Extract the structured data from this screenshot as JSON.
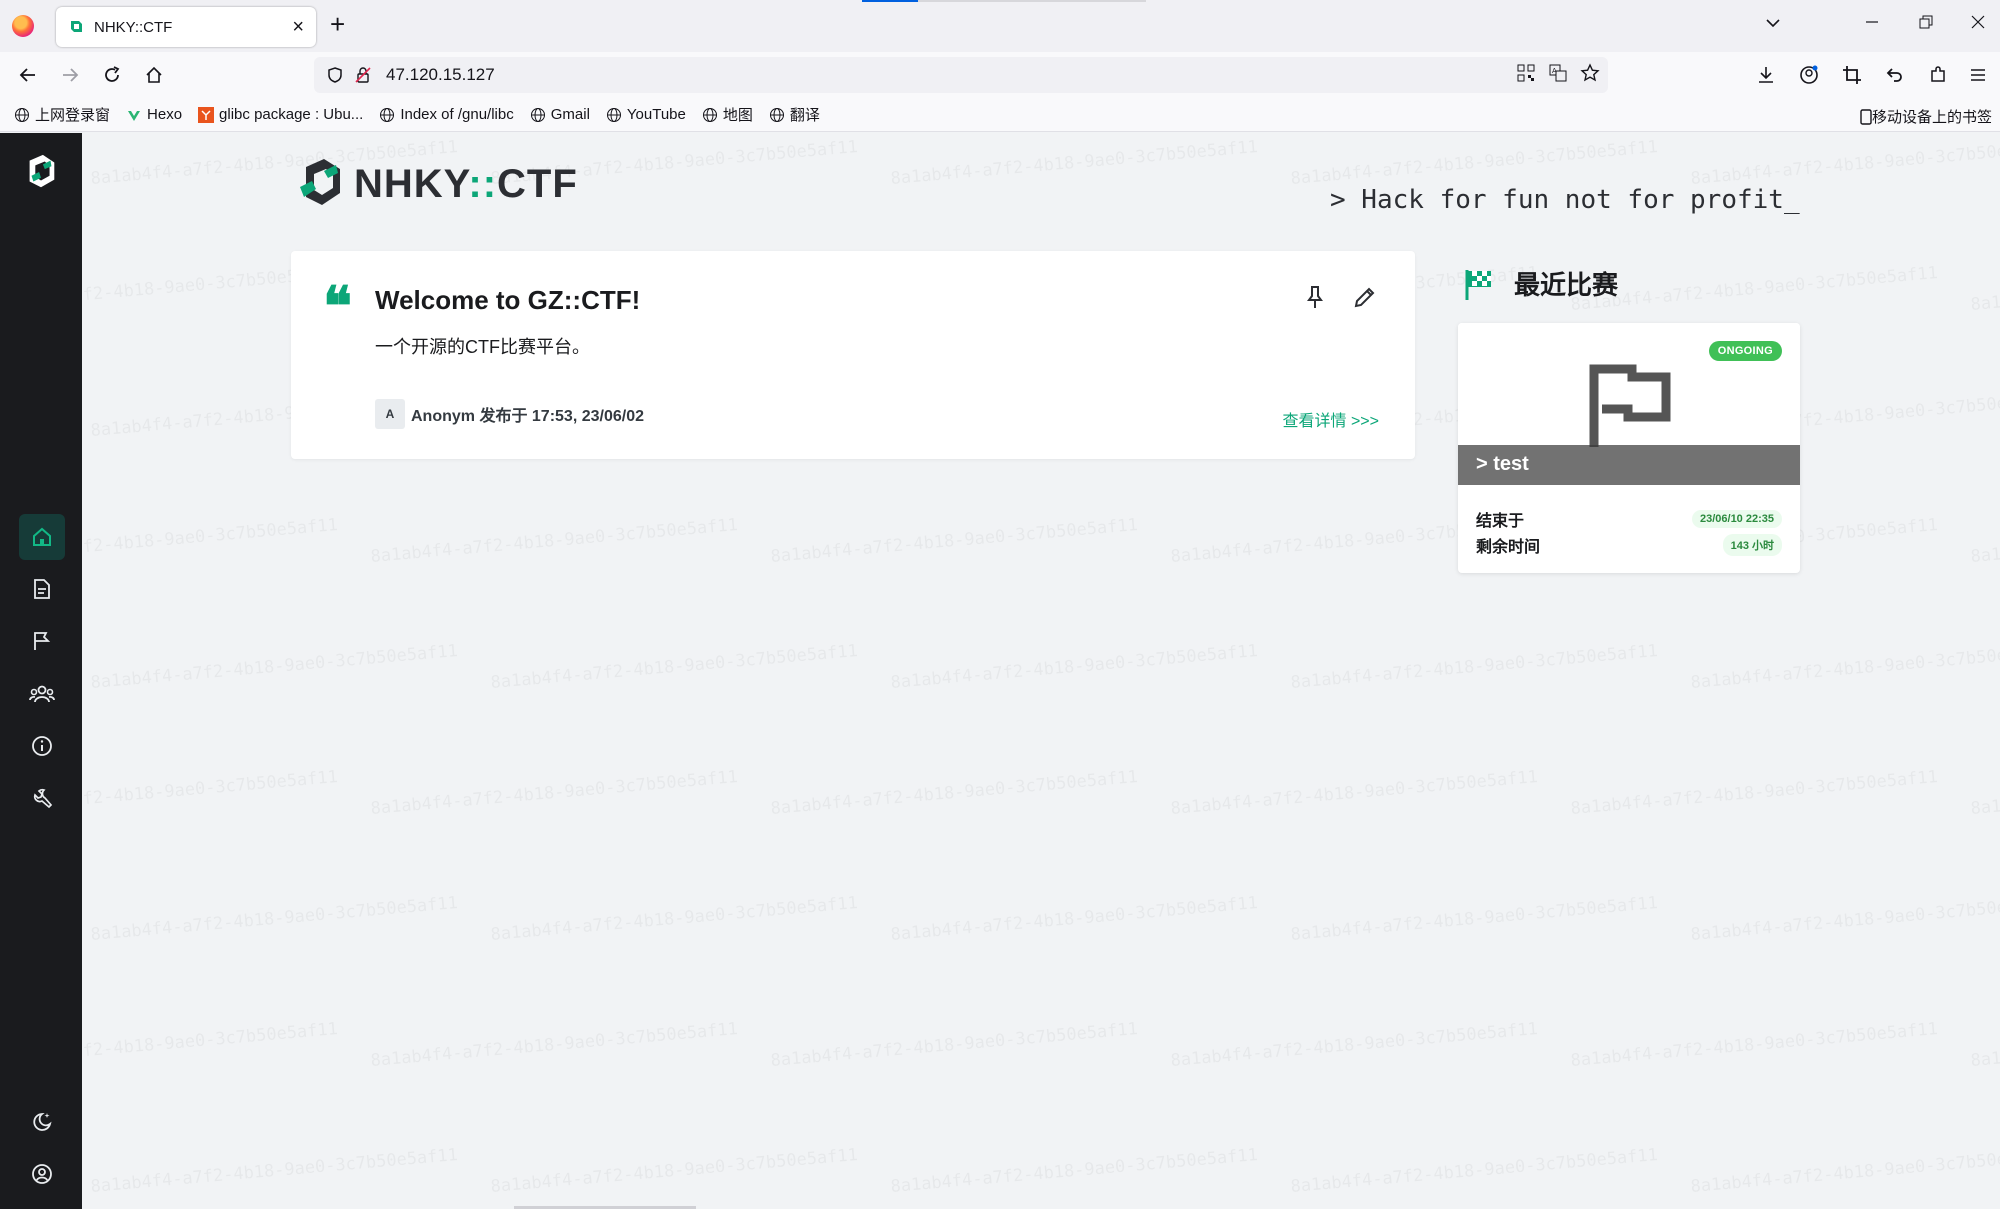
{
  "browser": {
    "tab_title": "NHKY::CTF",
    "url": "47.120.15.127",
    "bookmarks": [
      "上网登录窗",
      "Hexo",
      "glibc package : Ubu...",
      "Index of /gnu/libc",
      "Gmail",
      "YouTube",
      "地图",
      "翻译"
    ],
    "bookmarks_right": "移动设备上的书签"
  },
  "app": {
    "brand_name": "NHKY",
    "brand_sep": "::",
    "brand_suffix": "CTF",
    "slogan": "> Hack for fun not for profit_",
    "watermark_text": "8a1ab4f4-a7f2-4b18-9ae0-3c7b50e5af11"
  },
  "post": {
    "title": "Welcome to GZ::CTF!",
    "summary": "一个开源的CTF比赛平台。",
    "avatar_letter": "A",
    "author_line": "Anonym 发布于 17:53, 23/06/02",
    "more_link": "查看详情 >>>"
  },
  "recent": {
    "title": "最近比赛",
    "game": {
      "status": "ONGOING",
      "title": "> test",
      "end_label": "结束于",
      "end_value": "23/06/10 22:35",
      "remain_label": "剩余时间",
      "remain_value": "143 小时"
    }
  },
  "colors": {
    "accent": "#0ca678",
    "sidebar_bg": "#1a1b1e",
    "ongoing": "#40c057"
  }
}
